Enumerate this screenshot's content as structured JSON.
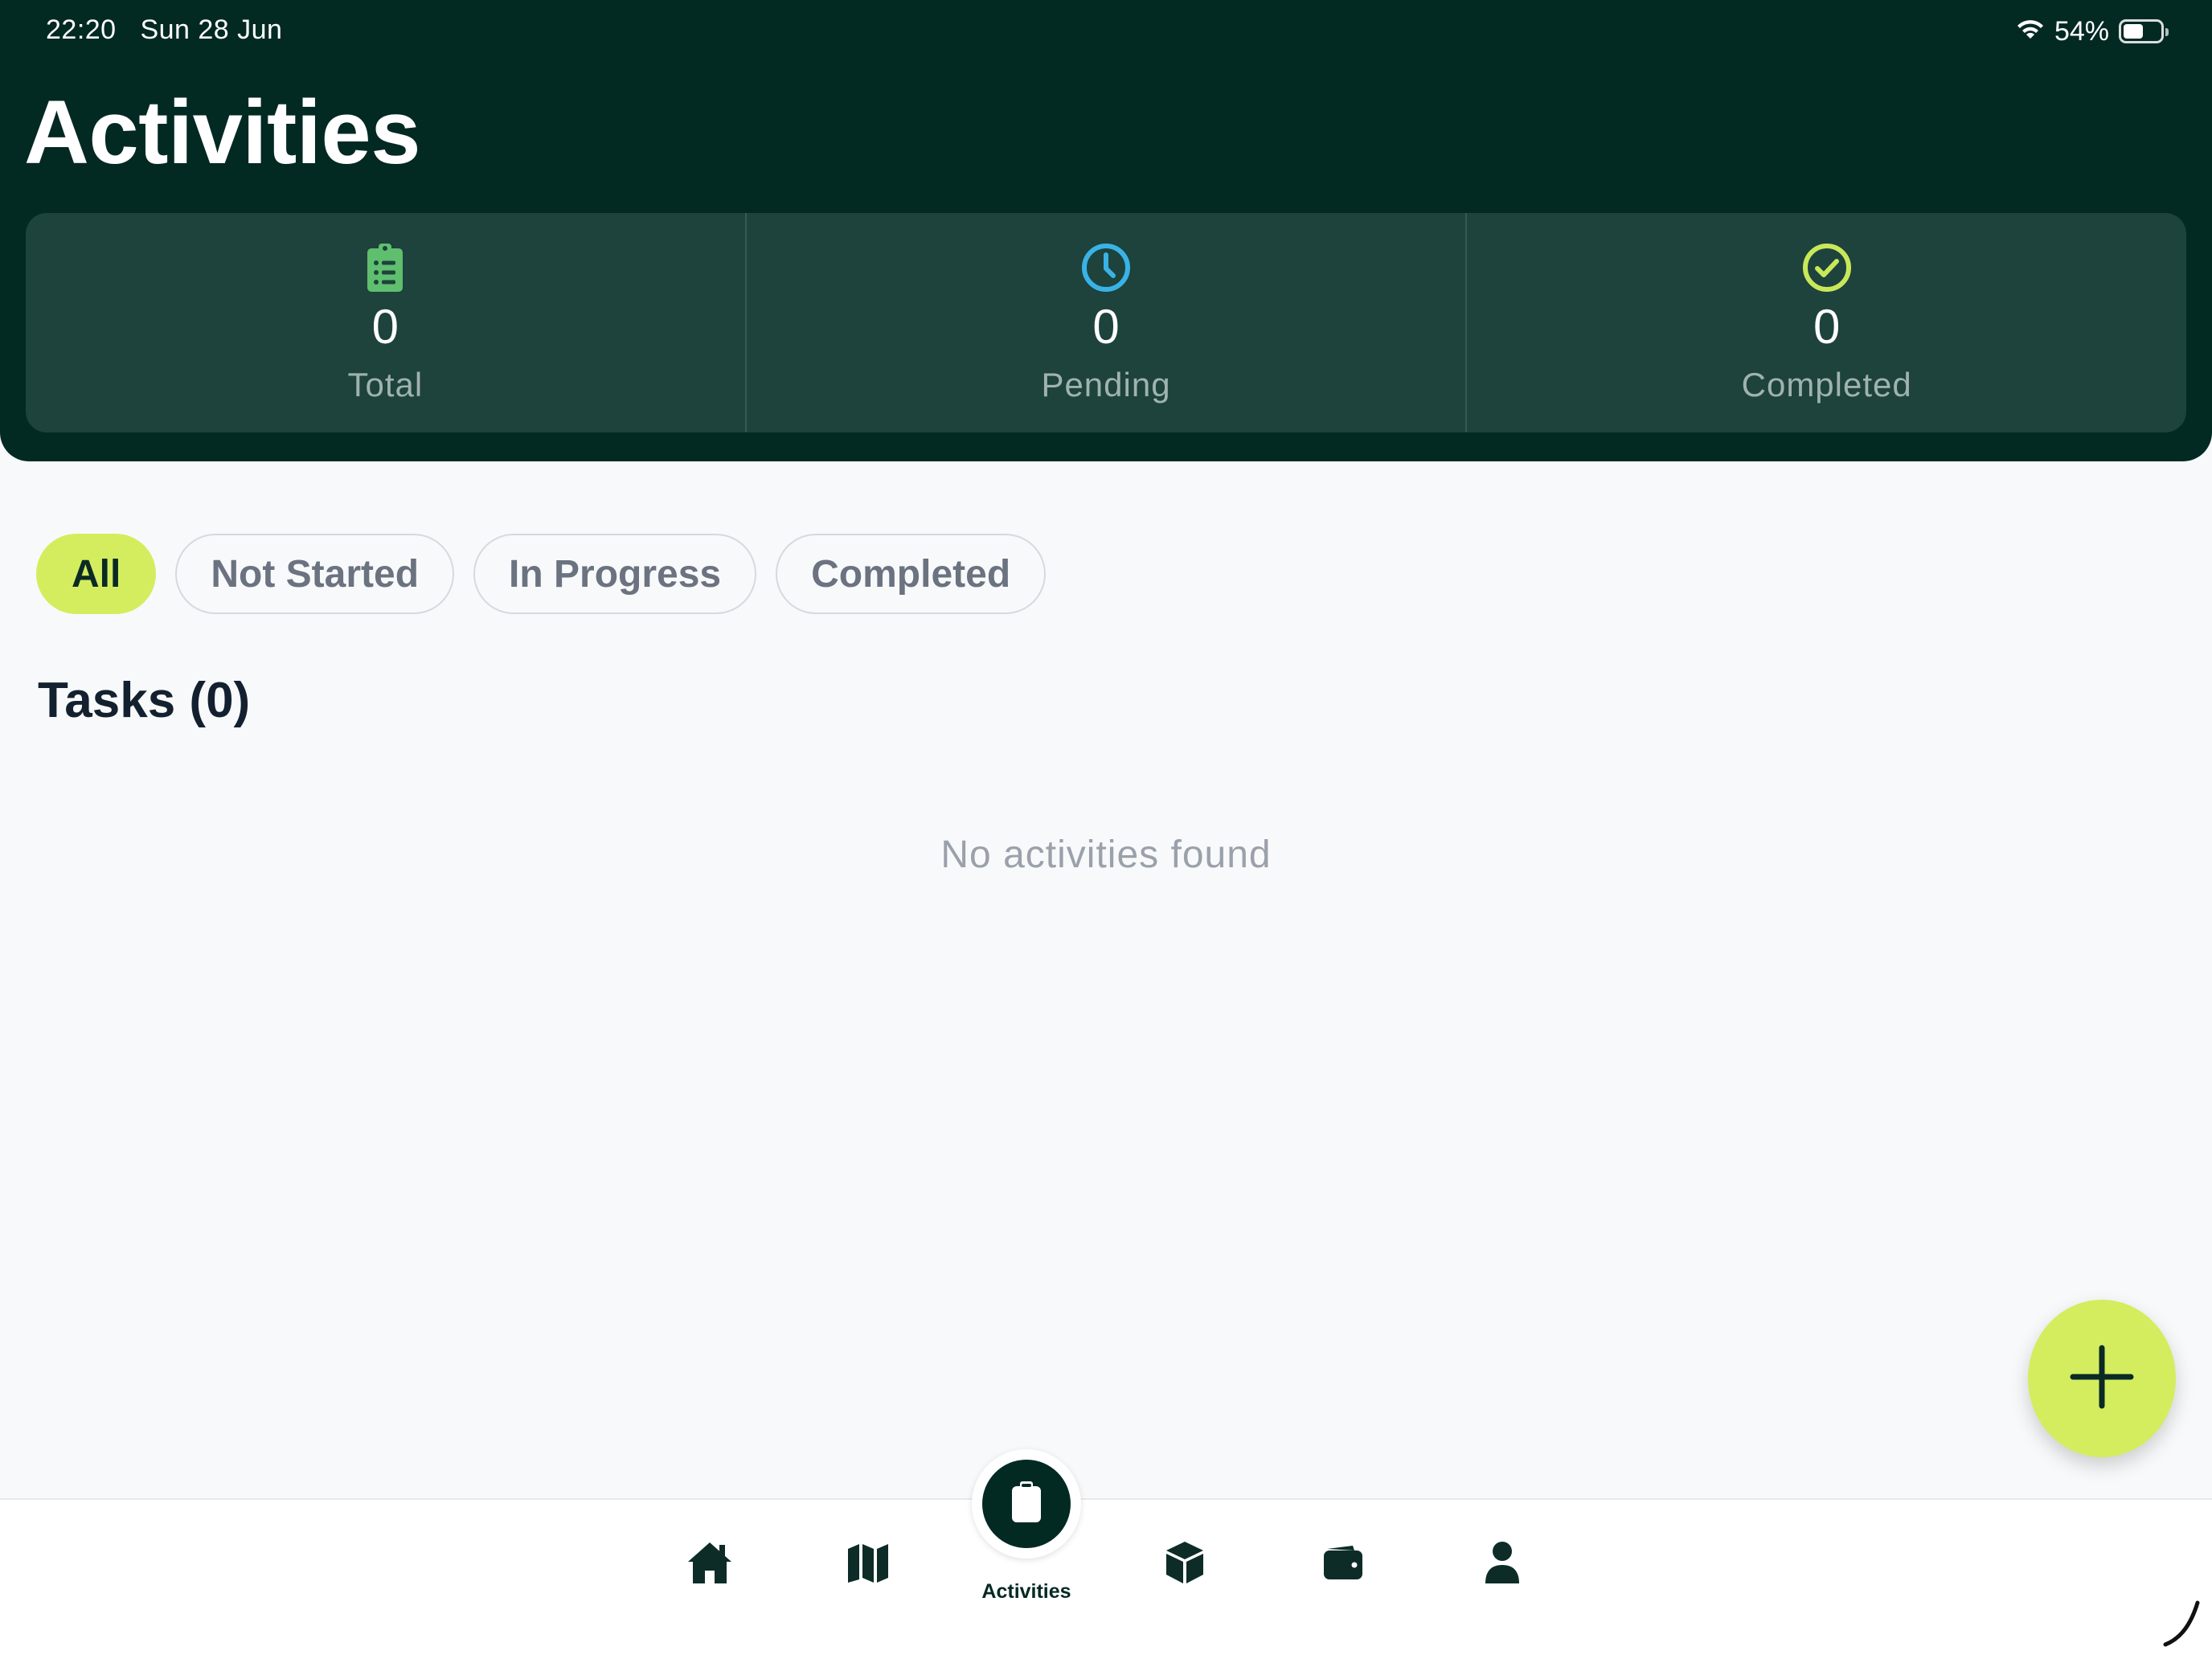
{
  "status_bar": {
    "time": "22:20",
    "date": "Sun 28 Jun",
    "battery_percent": "54%",
    "battery_level": 0.54,
    "wifi_icon": "wifi-icon"
  },
  "header": {
    "title": "Activities"
  },
  "stats": [
    {
      "icon": "clipboard-list-icon",
      "value": "0",
      "label": "Total",
      "color": "#5fbf6f"
    },
    {
      "icon": "clock-icon",
      "value": "0",
      "label": "Pending",
      "color": "#39b3e6"
    },
    {
      "icon": "check-circle-icon",
      "value": "0",
      "label": "Completed",
      "color": "#c8e85a"
    }
  ],
  "filters": {
    "items": [
      "All",
      "Not Started",
      "In Progress",
      "Completed"
    ],
    "selected": "All"
  },
  "tasks": {
    "heading": "Tasks (0)",
    "empty_message": "No activities found"
  },
  "fab": {
    "icon": "plus-icon"
  },
  "bottom_nav": {
    "items": [
      {
        "icon": "home-icon"
      },
      {
        "icon": "map-icon"
      },
      {
        "icon": "clipboard-icon",
        "label": "Activities",
        "active": true
      },
      {
        "icon": "cube-icon"
      },
      {
        "icon": "wallet-icon"
      },
      {
        "icon": "user-icon"
      }
    ]
  },
  "colors": {
    "header_bg": "#032923",
    "card_bg": "#1e423c",
    "accent": "#d4ed5e",
    "page_bg": "#f8f9fa"
  }
}
